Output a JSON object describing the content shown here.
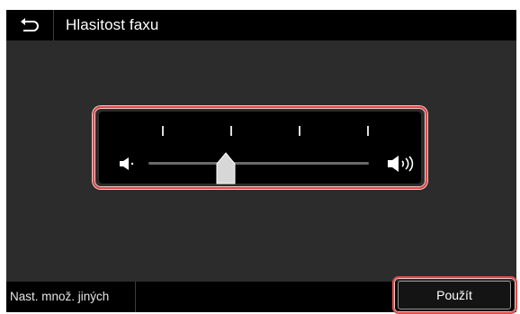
{
  "header": {
    "back_icon": "back-arrow-icon",
    "title": "Hlasitost faxu"
  },
  "volume_slider": {
    "min_icon": "speaker-low-icon",
    "max_icon": "speaker-high-icon",
    "current_level_fraction": 0.33,
    "tick_count": 4
  },
  "footer": {
    "other_settings_label": "Nast. množ. jiných",
    "apply_label": "Použít"
  },
  "colors": {
    "highlight": "#e04a4a",
    "background": "#2c2c2c",
    "bar": "#000000"
  }
}
